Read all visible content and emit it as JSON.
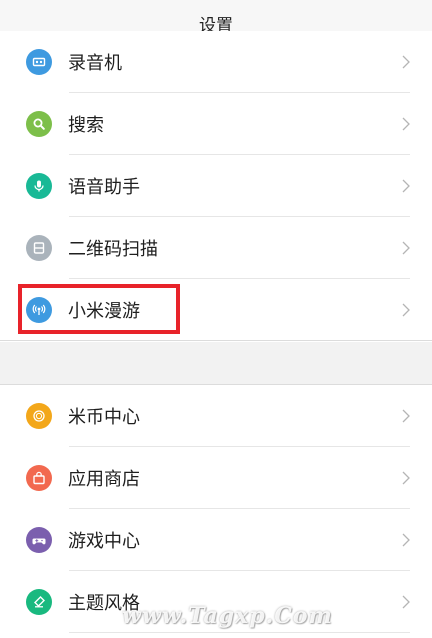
{
  "header": {
    "title": "设置"
  },
  "group1": [
    {
      "label": "录音机",
      "icon": "recorder-icon",
      "color": "#3e9ae0"
    },
    {
      "label": "搜索",
      "icon": "search-icon",
      "color": "#7dbf4a"
    },
    {
      "label": "语音助手",
      "icon": "microphone-icon",
      "color": "#19b996"
    },
    {
      "label": "二维码扫描",
      "icon": "qr-scan-icon",
      "color": "#aab3bb"
    },
    {
      "label": "小米漫游",
      "icon": "roaming-icon",
      "color": "#3e9ae0"
    }
  ],
  "group2": [
    {
      "label": "米币中心",
      "icon": "mi-coin-icon",
      "color": "#f3a71a"
    },
    {
      "label": "应用商店",
      "icon": "app-store-icon",
      "color": "#f2694f"
    },
    {
      "label": "游戏中心",
      "icon": "gamepad-icon",
      "color": "#7b5fae"
    },
    {
      "label": "主题风格",
      "icon": "theme-brush-icon",
      "color": "#19b97f"
    }
  ],
  "watermark": {
    "text": "www.Tagxp.Com"
  }
}
